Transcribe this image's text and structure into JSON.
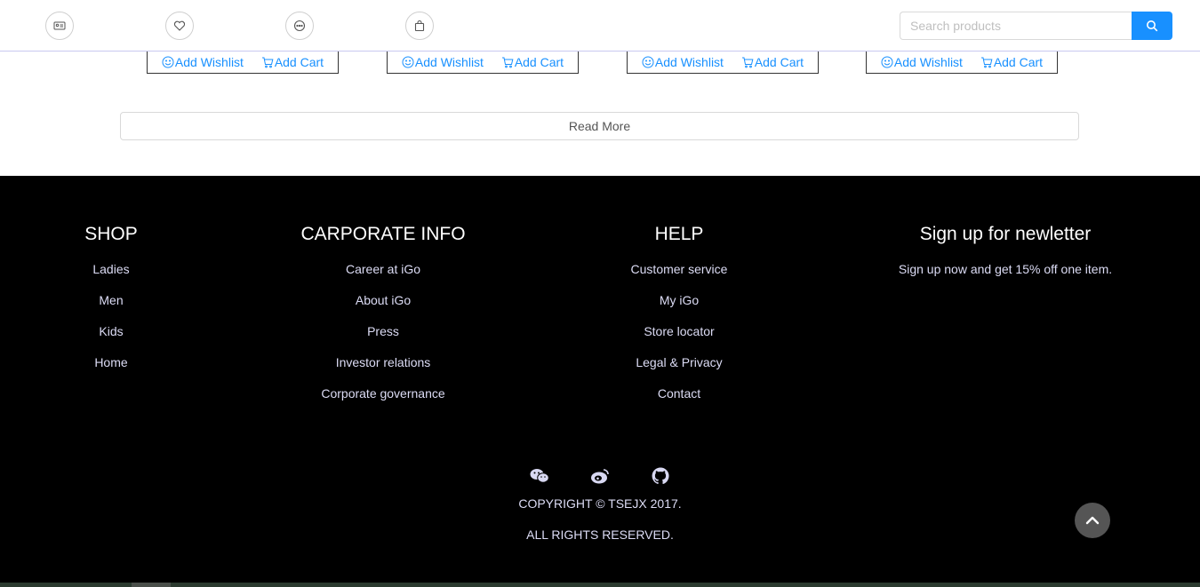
{
  "header": {
    "icons": [
      "contact-card-icon",
      "heart-icon",
      "chat-icon",
      "shopping-bag-icon"
    ],
    "search": {
      "placeholder": "Search products",
      "value": ""
    }
  },
  "products": {
    "actions": [
      {
        "wishlist": "Add Wishlist",
        "cart": "Add Cart"
      },
      {
        "wishlist": "Add Wishlist",
        "cart": "Add Cart"
      },
      {
        "wishlist": "Add Wishlist",
        "cart": "Add Cart"
      },
      {
        "wishlist": "Add Wishlist",
        "cart": "Add Cart"
      }
    ],
    "read_more": "Read More"
  },
  "footer": {
    "shop": {
      "title": "SHOP",
      "links": [
        "Ladies",
        "Men",
        "Kids",
        "Home"
      ]
    },
    "corporate": {
      "title": "CARPORATE INFO",
      "links": [
        "Career at iGo",
        "About iGo",
        "Press",
        "Investor relations",
        "Corporate governance"
      ]
    },
    "help": {
      "title": "HELP",
      "links": [
        "Customer service",
        "My iGo",
        "Store locator",
        "Legal & Privacy",
        "Contact"
      ]
    },
    "newsletter": {
      "title": "Sign up for newletter",
      "text": "Sign up now and get 15% off one item."
    },
    "social": [
      "wechat-icon",
      "weibo-icon",
      "github-icon"
    ],
    "copyright": "COPYRIGHT © TSEJX 2017.",
    "rights": "ALL RIGHTS RESERVED."
  },
  "colors": {
    "accent": "#1890ff",
    "footer_bg": "#000000",
    "footer_text": "#dcdcf5"
  }
}
